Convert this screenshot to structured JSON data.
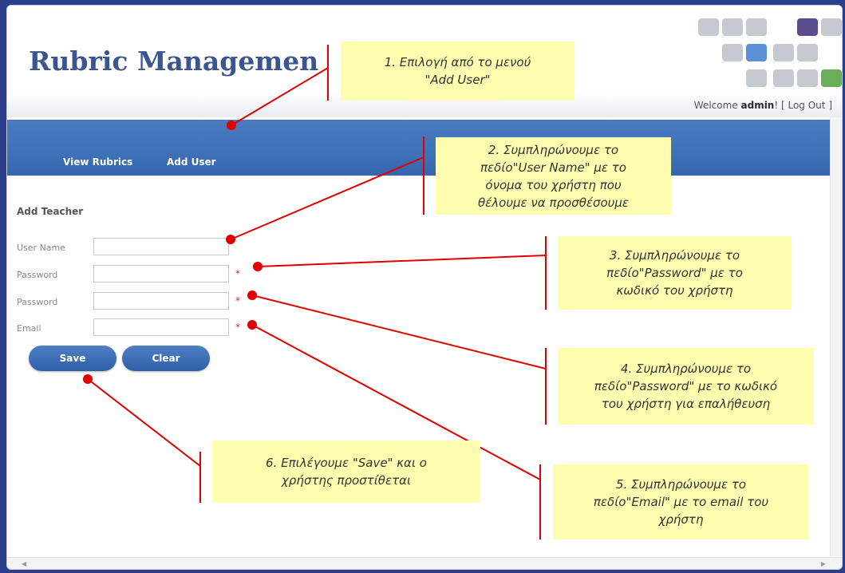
{
  "app_title": "Rubric Managemen",
  "header": {
    "welcome_prefix": "Welcome ",
    "username": "admin",
    "welcome_suffix": "! [ ",
    "logout": "Log Out",
    "close_bracket": " ]"
  },
  "nav": {
    "items": [
      {
        "label": "View Rubrics"
      },
      {
        "label": "Add User"
      }
    ]
  },
  "form": {
    "title": "Add Teacher",
    "fields": [
      {
        "label": "User Name",
        "value": "",
        "required": false
      },
      {
        "label": "Password",
        "value": "",
        "required": true,
        "required_mark": "*"
      },
      {
        "label": "Password",
        "value": "",
        "required": true,
        "required_mark": "*"
      },
      {
        "label": "Email",
        "value": "",
        "required": true,
        "required_mark": "*"
      }
    ],
    "save_label": "Save",
    "clear_label": "Clear"
  },
  "callouts": [
    {
      "line1": "1. Επιλογή από το μενού",
      "line2": "\"Add User\"",
      "line3": "",
      "line4": ""
    },
    {
      "line1": "2. Συμπληρώνουμε το",
      "line2": "πεδίο\"User Name\" με το",
      "line3": "όνομα του χρήστη που",
      "line4": "θέλουμε να προσθέσουμε"
    },
    {
      "line1": "3. Συμπληρώνουμε το",
      "line2": "πεδίο\"Password\" με το",
      "line3": "κωδικό του χρήστη",
      "line4": ""
    },
    {
      "line1": "4. Συμπληρώνουμε το",
      "line2": "πεδίο\"Password\" με το κωδικό",
      "line3": "του χρήστη για επαλήθευση",
      "line4": ""
    },
    {
      "line1": "5. Συμπληρώνουμε το",
      "line2": "πεδίο\"Email\" με το email του",
      "line3": "χρήστη",
      "line4": ""
    },
    {
      "line1": "6. Επιλέγουμε \"Save\" και ο",
      "line2": "χρήστης προστίθεται",
      "line3": "",
      "line4": ""
    }
  ],
  "colors": {
    "brand": "#3b5590",
    "nav": "#3f71b7",
    "annotation": "#e00000",
    "callout_bg": "#fffdb0",
    "logo_purple": "#5a4c8c",
    "logo_blue": "#5b8fd6",
    "logo_green": "#6aae5b"
  },
  "icons": [
    "scroll-left-arrow-icon",
    "scroll-right-arrow-icon",
    "logo-grid-icon"
  ]
}
